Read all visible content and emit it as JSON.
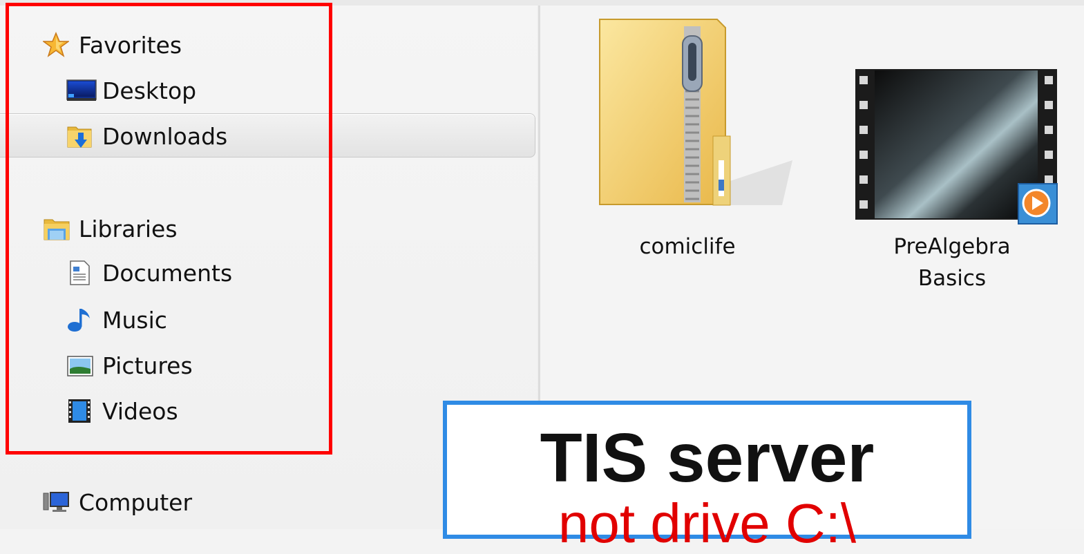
{
  "navigation": {
    "favorites": {
      "label": "Favorites",
      "icon": "star-icon",
      "items": [
        {
          "label": "Desktop",
          "icon": "desktop-icon"
        },
        {
          "label": "Downloads",
          "icon": "downloads-folder-icon",
          "selected": true
        }
      ]
    },
    "libraries": {
      "label": "Libraries",
      "icon": "libraries-icon",
      "items": [
        {
          "label": "Documents",
          "icon": "documents-icon"
        },
        {
          "label": "Music",
          "icon": "music-note-icon"
        },
        {
          "label": "Pictures",
          "icon": "pictures-icon"
        },
        {
          "label": "Videos",
          "icon": "film-strip-icon"
        }
      ]
    },
    "computer": {
      "label": "Computer",
      "icon": "computer-icon"
    }
  },
  "files": [
    {
      "name": "comiclife",
      "icon": "zip-folder-icon"
    },
    {
      "name_line1": "PreAlgebra",
      "name_line2": "Basics",
      "icon": "video-thumbnail-icon"
    }
  ],
  "callout": {
    "title": "TIS server",
    "subtitle": "not drive C:\\"
  },
  "colors": {
    "highlight_box": "#ff0000",
    "callout_border": "#2f8be5",
    "callout_subtitle": "#e10000"
  }
}
